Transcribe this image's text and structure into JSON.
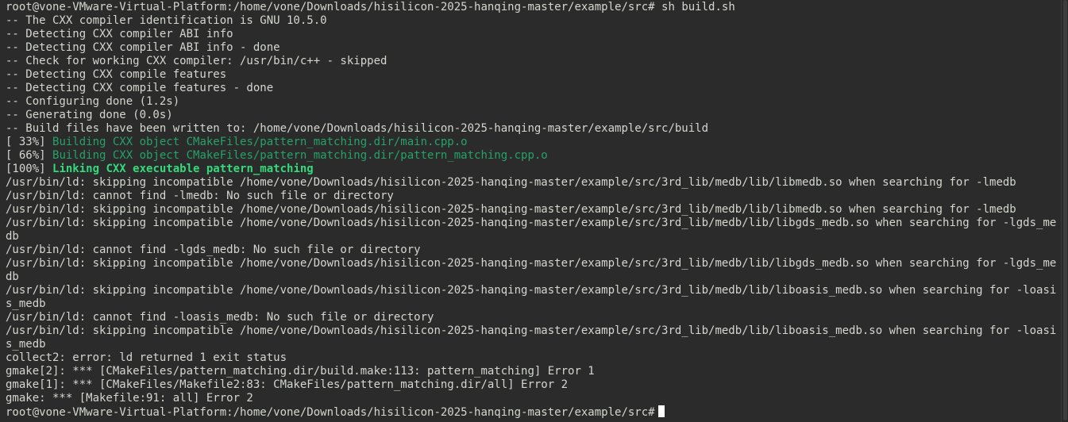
{
  "terminal": {
    "prompt": "root@vone-VMware-Virtual-Platform:/home/vone/Downloads/hisilicon-2025-hanqing-master/example/src#",
    "command": "sh build.sh",
    "cmake_lines": [
      "-- The CXX compiler identification is GNU 10.5.0",
      "-- Detecting CXX compiler ABI info",
      "-- Detecting CXX compiler ABI info - done",
      "-- Check for working CXX compiler: /usr/bin/c++ - skipped",
      "-- Detecting CXX compile features",
      "-- Detecting CXX compile features - done",
      "-- Configuring done (1.2s)",
      "-- Generating done (0.0s)",
      "-- Build files have been written to: /home/vone/Downloads/hisilicon-2025-hanqing-master/example/src/build"
    ],
    "build_steps": [
      {
        "pct": "[ 33%]",
        "text": "Building CXX object CMakeFiles/pattern_matching.dir/main.cpp.o"
      },
      {
        "pct": "[ 66%]",
        "text": "Building CXX object CMakeFiles/pattern_matching.dir/pattern_matching.cpp.o"
      },
      {
        "pct": "[100%]",
        "text": "Linking CXX executable pattern_matching"
      }
    ],
    "linker_lines": [
      "/usr/bin/ld: skipping incompatible /home/vone/Downloads/hisilicon-2025-hanqing-master/example/src/3rd_lib/medb/lib/libmedb.so when searching for -lmedb",
      "/usr/bin/ld: cannot find -lmedb: No such file or directory",
      "/usr/bin/ld: skipping incompatible /home/vone/Downloads/hisilicon-2025-hanqing-master/example/src/3rd_lib/medb/lib/libmedb.so when searching for -lmedb",
      "/usr/bin/ld: skipping incompatible /home/vone/Downloads/hisilicon-2025-hanqing-master/example/src/3rd_lib/medb/lib/libgds_medb.so when searching for -lgds_me",
      "db",
      "/usr/bin/ld: cannot find -lgds_medb: No such file or directory",
      "/usr/bin/ld: skipping incompatible /home/vone/Downloads/hisilicon-2025-hanqing-master/example/src/3rd_lib/medb/lib/libgds_medb.so when searching for -lgds_me",
      "db",
      "/usr/bin/ld: skipping incompatible /home/vone/Downloads/hisilicon-2025-hanqing-master/example/src/3rd_lib/medb/lib/liboasis_medb.so when searching for -loasi",
      "s_medb",
      "/usr/bin/ld: cannot find -loasis_medb: No such file or directory",
      "/usr/bin/ld: skipping incompatible /home/vone/Downloads/hisilicon-2025-hanqing-master/example/src/3rd_lib/medb/lib/liboasis_medb.so when searching for -loasi",
      "s_medb",
      "collect2: error: ld returned 1 exit status",
      "gmake[2]: *** [CMakeFiles/pattern_matching.dir/build.make:113: pattern_matching] Error 1",
      "gmake[1]: *** [CMakeFiles/Makefile2:83: CMakeFiles/pattern_matching.dir/all] Error 2",
      "gmake: *** [Makefile:91: all] Error 2"
    ],
    "colors": {
      "background": "#2b2b2b",
      "foreground": "#d3d7cf",
      "build_green": "#26a269",
      "link_green_bold": "#33da7a",
      "cursor": "#ffffff"
    }
  }
}
